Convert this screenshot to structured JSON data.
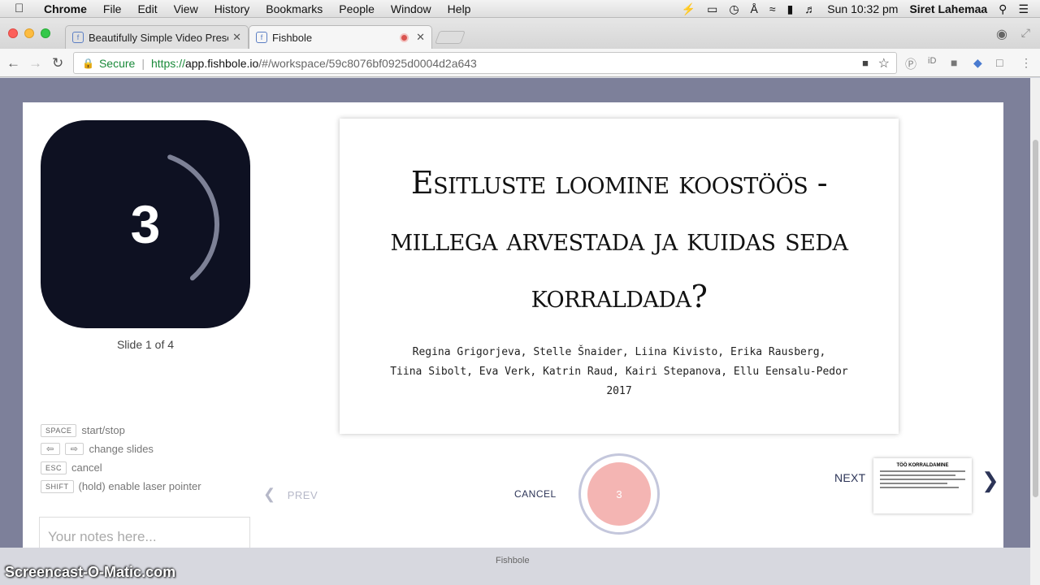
{
  "os_menubar": {
    "apple": "",
    "app": "Chrome",
    "menus": [
      "File",
      "Edit",
      "View",
      "History",
      "Bookmarks",
      "People",
      "Window",
      "Help"
    ],
    "clock": "Sun 10:32 pm",
    "user": "Siret Lahemaa"
  },
  "browser": {
    "tabs": [
      {
        "label": "Beautifully Simple Video Prese"
      },
      {
        "label": "Fishbole"
      }
    ],
    "address": {
      "secure_label": "Secure",
      "protocol": "https://",
      "host": "app.fishbole.io",
      "path": "/#/workspace/59c8076bf0925d0004d2a643"
    }
  },
  "presenter": {
    "countdown": "3",
    "countdown_progress": 0.33,
    "slide_counter": "Slide 1 of 4",
    "shortcuts": [
      {
        "key": "SPACE",
        "label": "start/stop"
      },
      {
        "key": "⇦ ⇨",
        "label": "change slides"
      },
      {
        "key": "ESC",
        "label": "cancel"
      },
      {
        "key": "SHIFT",
        "label": "(hold) enable laser pointer"
      }
    ],
    "notes_placeholder": "Your notes here...",
    "slide": {
      "title": "Esitluste loomine koostöös - millega arvestada ja kuidas seda korraldada?",
      "authors_line1": "Regina Grigorjeva, Stelle Šnaider, Liina Kivisto, Erika Rausberg,",
      "authors_line2": "Tiina Sibolt, Eva Verk, Katrin Raud, Kairi Stepanova, Ellu Eensalu-Pedor",
      "year": "2017"
    },
    "controls": {
      "prev": "PREV",
      "cancel": "CANCEL",
      "record_count": "3",
      "next": "NEXT"
    },
    "next_thumbnail_title": "TÖÖ KORRALDAMINE"
  },
  "footer_label": "Fishbole",
  "watermark": "Screencast-O-Matic.com",
  "colors": {
    "timer_bg": "#0e1122",
    "record_button": "#f4b5b3",
    "accent_text": "#2c3457"
  }
}
